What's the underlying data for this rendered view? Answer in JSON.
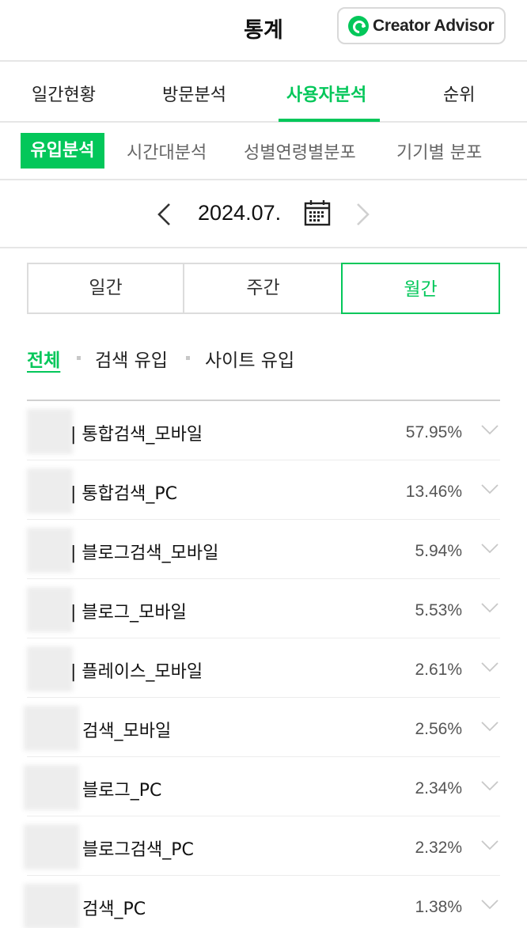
{
  "header": {
    "title": "통계",
    "creator_button": {
      "label": "Creator Advisor",
      "icon": "creator-advisor-logo-icon",
      "brand_color": "#03c75a"
    }
  },
  "main_tabs": [
    {
      "label": "일간현황",
      "active": false
    },
    {
      "label": "방문분석",
      "active": false
    },
    {
      "label": "사용자분석",
      "active": true
    },
    {
      "label": "순위",
      "active": false
    }
  ],
  "sub_tabs": [
    {
      "label": "유입분석",
      "active": true
    },
    {
      "label": "시간대분석",
      "active": false
    },
    {
      "label": "성별연령별분포",
      "active": false
    },
    {
      "label": "기기별 분포",
      "active": false
    }
  ],
  "date_nav": {
    "label": "2024.07.",
    "prev_icon": "chevron-left-icon",
    "next_icon": "chevron-right-icon",
    "calendar_icon": "calendar-icon"
  },
  "period": [
    {
      "label": "일간",
      "active": false
    },
    {
      "label": "주간",
      "active": false
    },
    {
      "label": "월간",
      "active": true
    }
  ],
  "filters": [
    {
      "label": "전체",
      "active": true
    },
    {
      "label": "검색 유입",
      "active": false
    },
    {
      "label": "사이트 유입",
      "active": false
    }
  ],
  "rows": [
    {
      "label": "| 통합검색_모바일",
      "percent": "57.95%"
    },
    {
      "label": "| 통합검색_PC",
      "percent": "13.46%"
    },
    {
      "label": "| 블로그검색_모바일",
      "percent": "5.94%"
    },
    {
      "label": "| 블로그_모바일",
      "percent": "5.53%"
    },
    {
      "label": "| 플레이스_모바일",
      "percent": "2.61%"
    },
    {
      "label": "검색_모바일",
      "percent": "2.56%"
    },
    {
      "label": "블로그_PC",
      "percent": "2.34%"
    },
    {
      "label": "블로그검색_PC",
      "percent": "2.32%"
    },
    {
      "label": "검색_PC",
      "percent": "1.38%"
    }
  ],
  "colors": {
    "accent": "#03c75a",
    "divider": "#e6e6e6"
  }
}
